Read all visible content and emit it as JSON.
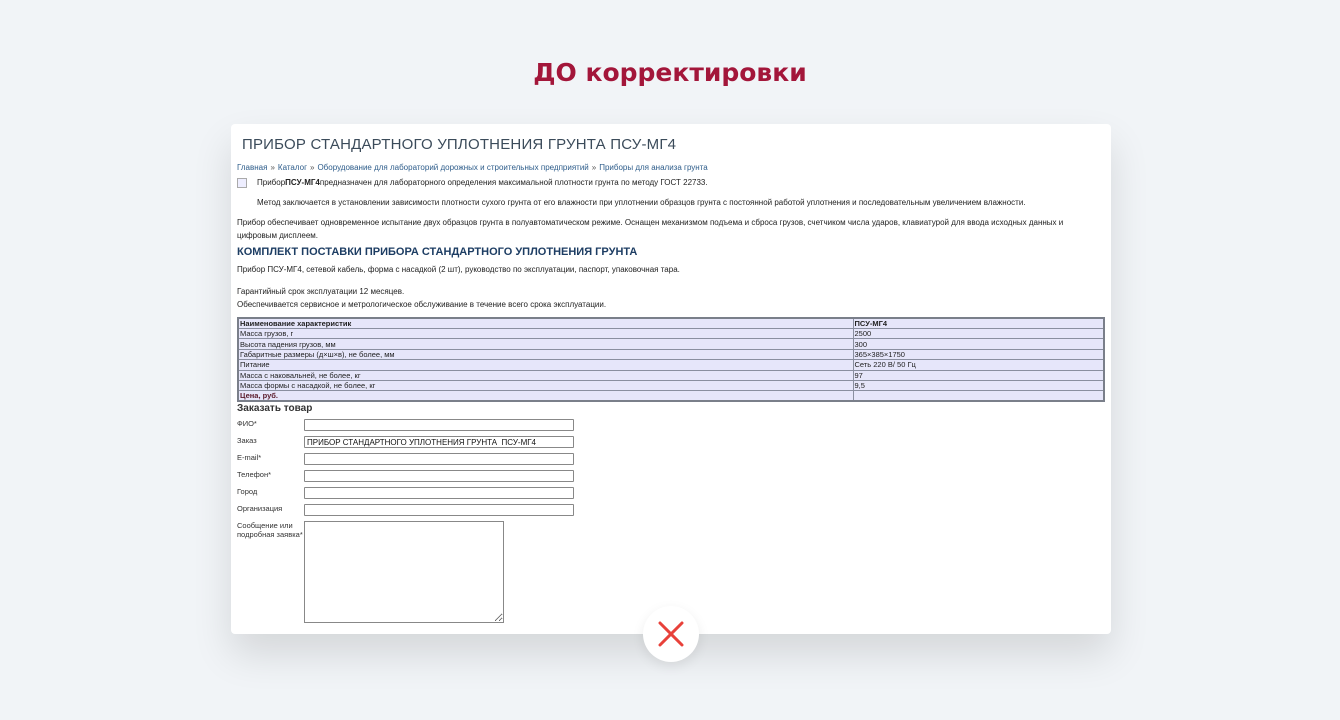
{
  "heading": "ДО корректировки",
  "page": {
    "title": "ПРИБОР СТАНДАРТНОГО УПЛОТНЕНИЯ ГРУНТА ПСУ-МГ4",
    "breadcrumbs": [
      "Главная",
      "Каталог",
      "Оборудование для лабораторий дорожных и строительных предприятий",
      "Приборы для анализа грунта"
    ],
    "breadcrumb_sep": "»",
    "intro_prefix": "Прибор ",
    "intro_bold": "ПСУ-МГ4",
    "intro_rest": " предназначен для лабораторного определения максимальной плотности грунта по методу ГОСТ 22733.",
    "method": "Метод заключается в установлении зависимости плотности сухого грунта от его влажности при уплотнении образцов грунта с постоянной работой уплотнения и последовательным увеличением влажности.",
    "description": "Прибор обеспечивает одновременное испытание двух образцов грунта в полуавтоматическом режиме. Оснащен механизмом подъема и сброса грузов, счетчиком числа ударов, клавиатурой для ввода исходных данных и цифровым дисплеем.",
    "kit_heading": "КОМПЛЕКТ ПОСТАВКИ ПРИБОРА СТАНДАРТНОГО УПЛОТНЕНИЯ ГРУНТА",
    "kit_text": "Прибор ПСУ-МГ4, сетевой кабель, форма с насадкой (2 шт), руководство по эксплуатации, паспорт, упаковочная тара.",
    "warranty": "Гарантийный срок эксплуатации 12 месяцев.",
    "service": "Обеспечивается сервисное и метрологическое обслуживание в течение всего срока эксплуатации.",
    "table": {
      "header": [
        "Наименование характеристик",
        "ПСУ-МГ4"
      ],
      "rows": [
        [
          "Масса грузов, г",
          "2500"
        ],
        [
          "Высота падения грузов, мм",
          "300"
        ],
        [
          "Габаритные размеры (д×ш×в), не более, мм",
          "365×385×1750"
        ],
        [
          "Питание",
          "Сеть 220 В/ 50 Гц"
        ],
        [
          "Масса с наковальней, не более, кг",
          "97"
        ],
        [
          "Масса формы с насадкой, не более, кг",
          "9,5"
        ]
      ],
      "price_label": "Цена, руб.",
      "price_value": ""
    },
    "form": {
      "title": "Заказать товар",
      "fio_label": "ФИО*",
      "fio_value": "",
      "order_label": "Заказ",
      "order_value": "ПРИБОР СТАНДАРТНОГО УПЛОТНЕНИЯ ГРУНТА  ПСУ-МГ4",
      "email_label": "E-mail*",
      "email_value": "",
      "phone_label": "Телефон*",
      "phone_value": "",
      "city_label": "Город",
      "city_value": "",
      "org_label": "Организация",
      "org_value": "",
      "message_label": "Сообщение или подробная заявка*",
      "message_value": ""
    }
  },
  "status_icon": "close-icon",
  "colors": {
    "heading": "#a3163a",
    "close": "#e8413a"
  }
}
